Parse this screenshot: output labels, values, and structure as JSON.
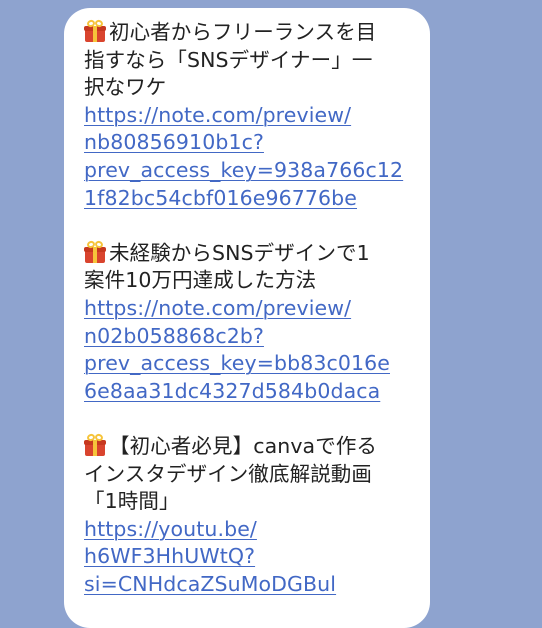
{
  "message": {
    "items": [
      {
        "icon": "gift-icon",
        "title_lines": [
          "初心者からフリーランスを目",
          "指すなら「SNSデザイナー」一",
          "択なワケ"
        ],
        "url_lines": [
          "https://note.com/preview/",
          "nb80856910b1c?",
          "prev_access_key=938a766c12",
          "1f82bc54cbf016e96776be"
        ]
      },
      {
        "icon": "gift-icon",
        "title_lines": [
          "未経験からSNSデザインで1",
          "案件10万円達成した方法"
        ],
        "url_lines": [
          "https://note.com/preview/",
          "n02b058868c2b?",
          "prev_access_key=bb83c016e",
          "6e8aa31dc4327d584b0daca"
        ]
      },
      {
        "icon": "gift-icon",
        "title_lines": [
          "【初心者必見】canvaで作る",
          "インスタデザイン徹底解説動画",
          "「1時間」"
        ],
        "url_lines": [
          "https://youtu.be/",
          "h6WF3HhUWtQ?",
          "si=CNHdcaZSuMoDGBul"
        ]
      }
    ]
  },
  "colors": {
    "background": "#8ea3cf",
    "bubble": "#ffffff",
    "link": "#4268c5",
    "text": "#222222"
  }
}
